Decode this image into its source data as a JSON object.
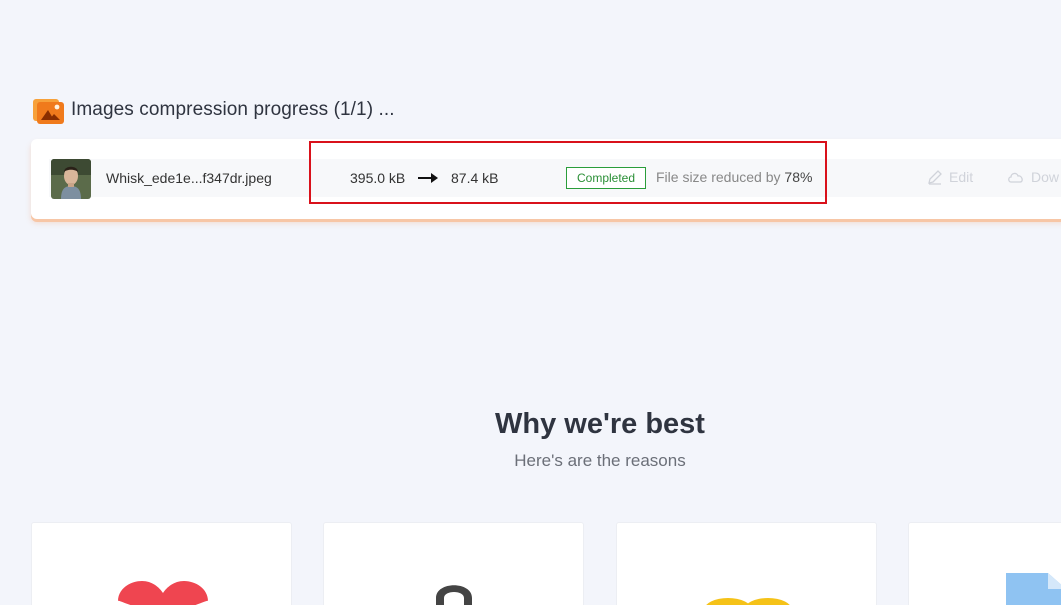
{
  "progress": {
    "title": "Images compression progress (1/1) ...",
    "icon": "image-icon"
  },
  "file": {
    "name": "Whisk_ede1e...f347dr.jpeg",
    "size_before": "395.0 kB",
    "size_after": "87.4 kB",
    "status": "Completed",
    "reduced_label": "File size reduced by",
    "reduced_pct": "78%",
    "edit_label": "Edit",
    "download_label": "Dow"
  },
  "why": {
    "title": "Why we're best",
    "subtitle": "Here's are the reasons"
  },
  "features": [
    {
      "icon": "heart-icon"
    },
    {
      "icon": "lock-icon"
    },
    {
      "icon": "coins-icon"
    },
    {
      "icon": "document-icon"
    }
  ],
  "colors": {
    "background": "#f3f5fb",
    "accent": "#f07a1c",
    "status_green": "#2a9d3a",
    "highlight_red": "#d9111b"
  }
}
